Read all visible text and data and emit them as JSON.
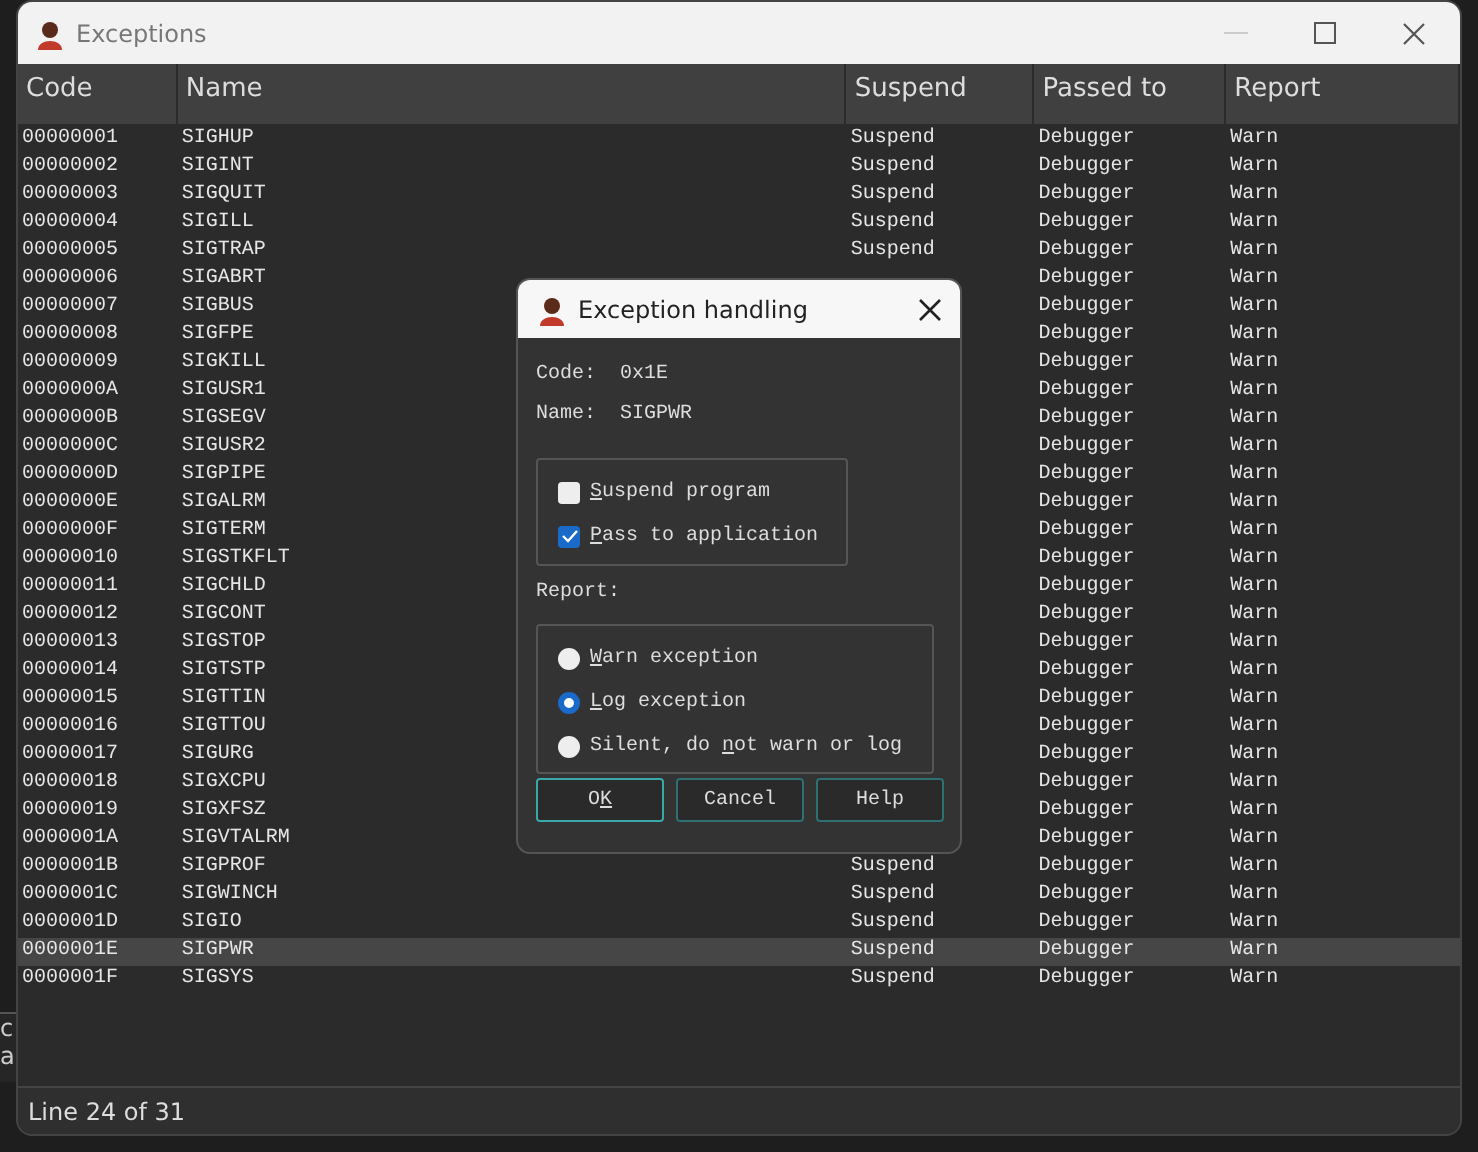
{
  "background_window": {
    "lines": [
      "c",
      "a"
    ]
  },
  "window": {
    "title": "Exceptions"
  },
  "table": {
    "columns": [
      "Code",
      "Name",
      "Suspend",
      "Passed to",
      "Report"
    ],
    "rows": [
      {
        "code": "00000001",
        "name": "SIGHUP",
        "suspend": "Suspend",
        "passed_to": "Debugger",
        "report": "Warn",
        "selected": false
      },
      {
        "code": "00000002",
        "name": "SIGINT",
        "suspend": "Suspend",
        "passed_to": "Debugger",
        "report": "Warn",
        "selected": false
      },
      {
        "code": "00000003",
        "name": "SIGQUIT",
        "suspend": "Suspend",
        "passed_to": "Debugger",
        "report": "Warn",
        "selected": false
      },
      {
        "code": "00000004",
        "name": "SIGILL",
        "suspend": "Suspend",
        "passed_to": "Debugger",
        "report": "Warn",
        "selected": false
      },
      {
        "code": "00000005",
        "name": "SIGTRAP",
        "suspend": "Suspend",
        "passed_to": "Debugger",
        "report": "Warn",
        "selected": false
      },
      {
        "code": "00000006",
        "name": "SIGABRT",
        "passed_to": "Debugger",
        "report": "Warn",
        "selected": false
      },
      {
        "code": "00000007",
        "name": "SIGBUS",
        "passed_to": "Debugger",
        "report": "Warn",
        "selected": false
      },
      {
        "code": "00000008",
        "name": "SIGFPE",
        "passed_to": "Debugger",
        "report": "Warn",
        "selected": false
      },
      {
        "code": "00000009",
        "name": "SIGKILL",
        "passed_to": "Debugger",
        "report": "Warn",
        "selected": false
      },
      {
        "code": "0000000A",
        "name": "SIGUSR1",
        "passed_to": "Debugger",
        "report": "Warn",
        "selected": false
      },
      {
        "code": "0000000B",
        "name": "SIGSEGV",
        "passed_to": "Debugger",
        "report": "Warn",
        "selected": false
      },
      {
        "code": "0000000C",
        "name": "SIGUSR2",
        "passed_to": "Debugger",
        "report": "Warn",
        "selected": false
      },
      {
        "code": "0000000D",
        "name": "SIGPIPE",
        "passed_to": "Debugger",
        "report": "Warn",
        "selected": false
      },
      {
        "code": "0000000E",
        "name": "SIGALRM",
        "passed_to": "Debugger",
        "report": "Warn",
        "selected": false
      },
      {
        "code": "0000000F",
        "name": "SIGTERM",
        "passed_to": "Debugger",
        "report": "Warn",
        "selected": false
      },
      {
        "code": "00000010",
        "name": "SIGSTKFLT",
        "passed_to": "Debugger",
        "report": "Warn",
        "selected": false
      },
      {
        "code": "00000011",
        "name": "SIGCHLD",
        "passed_to": "Debugger",
        "report": "Warn",
        "selected": false
      },
      {
        "code": "00000012",
        "name": "SIGCONT",
        "passed_to": "Debugger",
        "report": "Warn",
        "selected": false
      },
      {
        "code": "00000013",
        "name": "SIGSTOP",
        "passed_to": "Debugger",
        "report": "Warn",
        "selected": false
      },
      {
        "code": "00000014",
        "name": "SIGTSTP",
        "passed_to": "Debugger",
        "report": "Warn",
        "selected": false
      },
      {
        "code": "00000015",
        "name": "SIGTTIN",
        "passed_to": "Debugger",
        "report": "Warn",
        "selected": false
      },
      {
        "code": "00000016",
        "name": "SIGTTOU",
        "passed_to": "Debugger",
        "report": "Warn",
        "selected": false
      },
      {
        "code": "00000017",
        "name": "SIGURG",
        "passed_to": "Debugger",
        "report": "Warn",
        "selected": false
      },
      {
        "code": "00000018",
        "name": "SIGXCPU",
        "passed_to": "Debugger",
        "report": "Warn",
        "selected": false
      },
      {
        "code": "00000019",
        "name": "SIGXFSZ",
        "passed_to": "Debugger",
        "report": "Warn",
        "selected": false
      },
      {
        "code": "0000001A",
        "name": "SIGVTALRM",
        "passed_to": "Debugger",
        "report": "Warn",
        "selected": false
      },
      {
        "code": "0000001B",
        "name": "SIGPROF",
        "suspend": "Suspend",
        "passed_to": "Debugger",
        "report": "Warn",
        "selected": false
      },
      {
        "code": "0000001C",
        "name": "SIGWINCH",
        "suspend": "Suspend",
        "passed_to": "Debugger",
        "report": "Warn",
        "selected": false
      },
      {
        "code": "0000001D",
        "name": "SIGIO",
        "suspend": "Suspend",
        "passed_to": "Debugger",
        "report": "Warn",
        "selected": false
      },
      {
        "code": "0000001E",
        "name": "SIGPWR",
        "suspend": "Suspend",
        "passed_to": "Debugger",
        "report": "Warn",
        "selected": true
      },
      {
        "code": "0000001F",
        "name": "SIGSYS",
        "suspend": "Suspend",
        "passed_to": "Debugger",
        "report": "Warn",
        "selected": false
      }
    ]
  },
  "status_bar": {
    "text": "Line 24 of 31"
  },
  "dialog": {
    "title": "Exception handling",
    "fields": [
      {
        "label": "Code:",
        "value": "0x1E"
      },
      {
        "label": "Name:",
        "value": "SIGPWR"
      }
    ],
    "checkboxes": [
      {
        "key": "S",
        "after": "uspend program",
        "checked": false
      },
      {
        "key": "P",
        "after": "ass to application",
        "checked": true
      }
    ],
    "report_label": "Report:",
    "radios": [
      {
        "key": "W",
        "after": "arn exception",
        "selected": false
      },
      {
        "key": "L",
        "after": "og exception",
        "selected": true
      },
      {
        "before": "Silent, do ",
        "key": "n",
        "after": "ot warn or log",
        "selected": false
      }
    ],
    "buttons": [
      {
        "before": "O",
        "key": "K",
        "focused": true
      },
      {
        "before": "Cancel",
        "focused": false
      },
      {
        "before": "Help",
        "focused": false
      }
    ]
  }
}
